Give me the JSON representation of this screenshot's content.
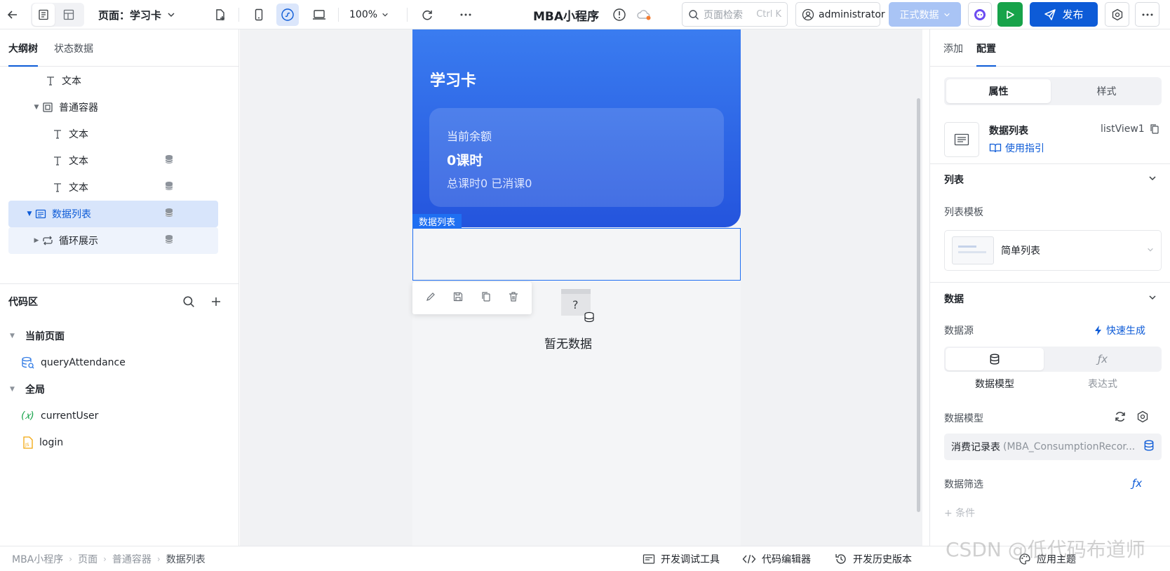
{
  "topbar": {
    "page_label": "页面：学习卡",
    "zoom": "100%",
    "app_title": "MBA小程序",
    "search_placeholder": "页面检索",
    "search_shortcut": "Ctrl K",
    "user": "administrator",
    "env": "正式数据",
    "publish": "发布"
  },
  "left": {
    "tabs": [
      "大纲树",
      "状态数据"
    ],
    "tree": [
      {
        "label": "文本"
      },
      {
        "label": "普通容器"
      },
      {
        "label": "文本"
      },
      {
        "label": "文本"
      },
      {
        "label": "文本"
      },
      {
        "label": "数据列表"
      },
      {
        "label": "循环展示"
      }
    ],
    "code_title": "代码区",
    "code": [
      {
        "label": "当前页面"
      },
      {
        "label": "queryAttendance"
      },
      {
        "label": "全局"
      },
      {
        "label": "currentUser"
      },
      {
        "label": "login"
      }
    ]
  },
  "canvas": {
    "card_title": "学习卡",
    "balance_label": "当前余额",
    "balance_value": "0课时",
    "summary": "总课时0 已消课0",
    "selection_tag": "数据列表",
    "empty_text": "暂无数据"
  },
  "right": {
    "tabs": [
      "添加",
      "配置"
    ],
    "seg": [
      "属性",
      "样式"
    ],
    "component_name": "数据列表",
    "guide": "使用指引",
    "component_id": "listView1",
    "list_section": "列表",
    "list_template_label": "列表模板",
    "list_template_value": "简单列表",
    "data_section": "数据",
    "data_source_label": "数据源",
    "quick_gen": "快速生成",
    "source_options": [
      "数据模型",
      "表达式"
    ],
    "model_label": "数据模型",
    "model_value": "消费记录表",
    "model_sub": "(MBA_ConsumptionRecor...",
    "filter_label": "数据筛选",
    "partial_text": "+ 条件"
  },
  "bottom": {
    "crumbs": [
      "MBA小程序",
      "页面",
      "普通容器",
      "数据列表"
    ],
    "dev_tools": "开发调试工具",
    "code_editor": "代码编辑器",
    "history": "开发历史版本",
    "theme": "应用主题"
  },
  "watermark": "CSDN @低代码布道师",
  "colors": {
    "primary": "#0d5bd7",
    "run": "#17a34a",
    "card_top": "#3a7cf0",
    "card_bottom": "#2454dd"
  }
}
